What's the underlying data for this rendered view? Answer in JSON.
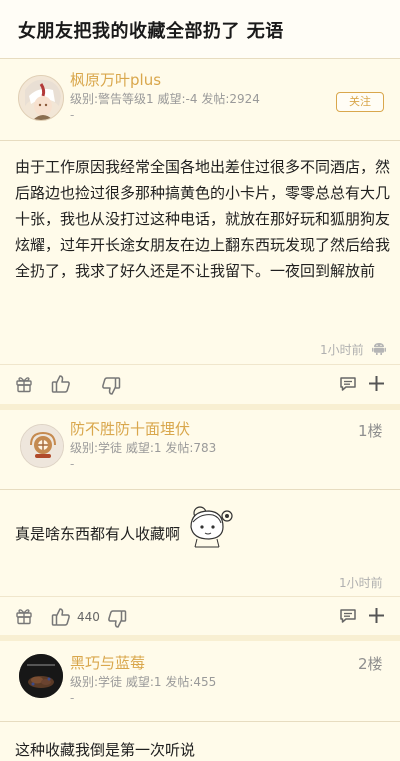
{
  "thread": {
    "title": "女朋友把我的收藏全部扔了 无语"
  },
  "posts": [
    {
      "author": "枫原万叶plus",
      "meta": "级别:警告等级1  威望:-4  发帖:2924",
      "signature": "-",
      "follow_label": "关注",
      "content": "由于工作原因我经常全国各地出差住过很多不同酒店，然后路边也捡过很多那种搞黄色的小卡片，零零总总有大几十张，我也从没打过这种电话，就放在那好玩和狐朋狗友炫耀，过年开长途女朋友在边上翻东西玩发现了然后给我全扔了，我求了好久还是不让我留下。一夜回到解放前",
      "time": "1小时前",
      "like_count": ""
    },
    {
      "author": "防不胜防十面埋伏",
      "meta": "级别:学徒  威望:1  发帖:783",
      "signature": "-",
      "floor": "1楼",
      "content": "真是啥东西都有人收藏啊",
      "time": "1小时前",
      "like_count": "440"
    },
    {
      "author": "黑巧与蓝莓",
      "meta": "级别:学徒  威望:1  发帖:455",
      "signature": "-",
      "floor": "2楼",
      "content": "这种收藏我倒是第一次听说"
    }
  ],
  "icons": {
    "gift": "gift-icon",
    "like": "thumbs-up-icon",
    "dislike": "thumbs-down-icon",
    "comment": "comment-icon",
    "more": "plus-icon",
    "platform": "android-icon"
  },
  "colors": {
    "background": "#fdf6e1",
    "author": "#d9a74c",
    "meta": "#9a9a9a"
  }
}
